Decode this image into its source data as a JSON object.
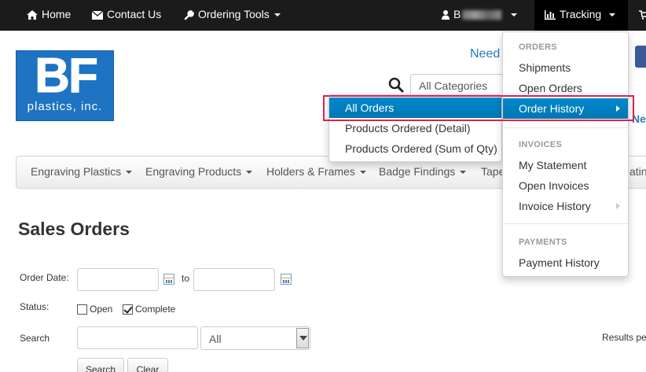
{
  "topnav": {
    "home": "Home",
    "contact": "Contact Us",
    "ordering_tools": "Ordering Tools",
    "user": "B",
    "tracking": "Tracking"
  },
  "logo": {
    "big": "BF",
    "small": "plastics, inc."
  },
  "header": {
    "need_link": "Need",
    "ne_link": "Ne",
    "category_select": "All Categories"
  },
  "categories": [
    "Engraving Plastics",
    "Engraving Products",
    "Holders & Frames",
    "Badge Findings",
    "Tape",
    "atin"
  ],
  "tracking_menu": {
    "orders_header": "ORDERS",
    "shipments": "Shipments",
    "open_orders": "Open Orders",
    "order_history": "Order History",
    "invoices_header": "INVOICES",
    "my_statement": "My Statement",
    "open_invoices": "Open Invoices",
    "invoice_history": "Invoice History",
    "payments_header": "PAYMENTS",
    "payment_history": "Payment History"
  },
  "order_history_menu": {
    "all_orders": "All Orders",
    "products_detail": "Products Ordered (Detail)",
    "products_sum": "Products Ordered (Sum of Qty)"
  },
  "page": {
    "title": "Sales Orders",
    "order_date_label": "Order Date:",
    "to_label": "to",
    "status_label": "Status:",
    "open_label": "Open",
    "open_checked": false,
    "complete_label": "Complete",
    "complete_checked": true,
    "search_label": "Search",
    "search_scope": "All",
    "search_button": "Search",
    "clear_button": "Clear",
    "results_per": "Results pe"
  }
}
